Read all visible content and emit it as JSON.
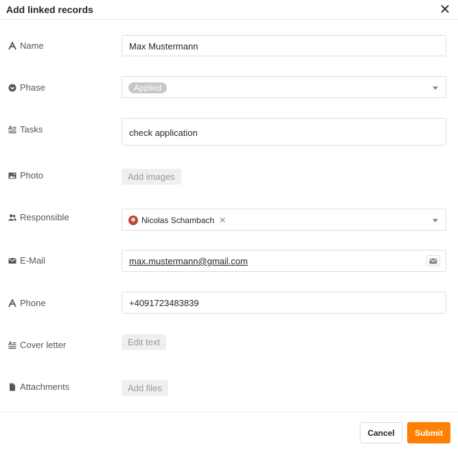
{
  "dialog": {
    "title": "Add linked records"
  },
  "fields": {
    "name": {
      "label": "Name",
      "icon": "text-icon",
      "value": "Max Mustermann"
    },
    "phase": {
      "label": "Phase",
      "icon": "single-select-icon",
      "value": "Applied"
    },
    "tasks": {
      "label": "Tasks",
      "icon": "long-text-icon",
      "value": "check application"
    },
    "photo": {
      "label": "Photo",
      "icon": "image-icon",
      "button": "Add images"
    },
    "responsible": {
      "label": "Responsible",
      "icon": "users-icon",
      "value": "Nicolas Schambach"
    },
    "email": {
      "label": "E-Mail",
      "icon": "mail-icon",
      "value": "max.mustermann@gmail.com"
    },
    "phone": {
      "label": "Phone",
      "icon": "text-icon",
      "value": "+4091723483839"
    },
    "cover_letter": {
      "label": "Cover letter",
      "icon": "long-text-icon",
      "button": "Edit text"
    },
    "attachments": {
      "label": "Attachments",
      "icon": "file-icon",
      "button": "Add files"
    }
  },
  "footer": {
    "cancel_label": "Cancel",
    "submit_label": "Submit"
  },
  "colors": {
    "accent": "#ff8000",
    "pill_grey": "#c7c7c7"
  }
}
